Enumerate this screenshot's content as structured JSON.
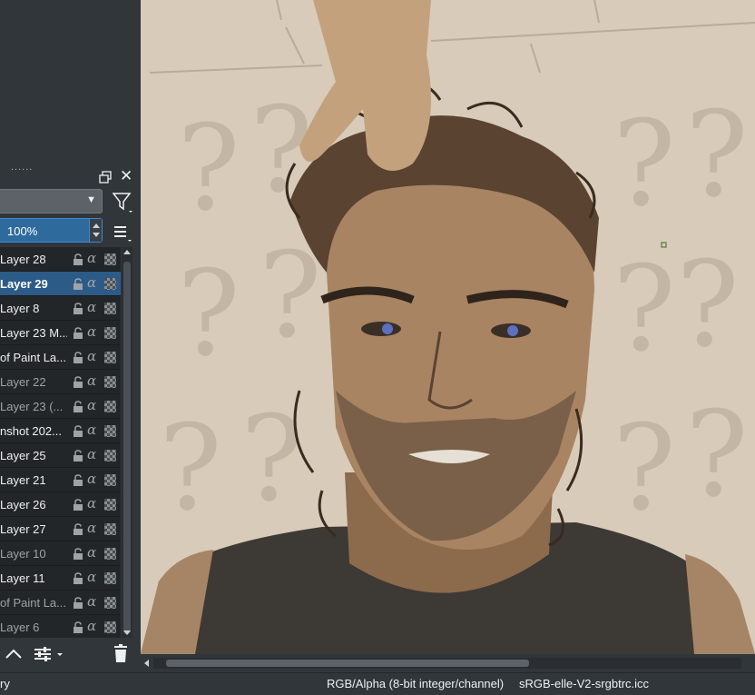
{
  "layers_panel": {
    "grip": "......",
    "opacity": "100%",
    "layers": [
      {
        "name": "Layer 28",
        "selected": false,
        "dim": false
      },
      {
        "name": "Layer 29",
        "selected": true,
        "dim": false
      },
      {
        "name": "Layer 8",
        "selected": false,
        "dim": false
      },
      {
        "name": "Layer 23 M...",
        "selected": false,
        "dim": false
      },
      {
        "name": "of Paint La...",
        "selected": false,
        "dim": false
      },
      {
        "name": "Layer 22",
        "selected": false,
        "dim": true
      },
      {
        "name": "Layer 23 (...",
        "selected": false,
        "dim": true
      },
      {
        "name": "nshot 202...",
        "selected": false,
        "dim": false
      },
      {
        "name": "Layer 25",
        "selected": false,
        "dim": false
      },
      {
        "name": "Layer 21",
        "selected": false,
        "dim": false
      },
      {
        "name": "Layer 26",
        "selected": false,
        "dim": false
      },
      {
        "name": "Layer 27",
        "selected": false,
        "dim": false
      },
      {
        "name": "Layer 10",
        "selected": false,
        "dim": true
      },
      {
        "name": "Layer 11",
        "selected": false,
        "dim": false
      },
      {
        "name": "of Paint La...",
        "selected": false,
        "dim": true
      },
      {
        "name": "Layer 6",
        "selected": false,
        "dim": true
      }
    ]
  },
  "statusbar": {
    "left_text": "ry",
    "color_model": "RGB/Alpha (8-bit integer/channel)",
    "profile": "sRGB-elle-V2-srgbtrc.icc"
  },
  "colors": {
    "accent": "#2c5b88",
    "panel_bg": "#31363b",
    "list_bg": "#232629",
    "canvas_bg": "#d8cbb9"
  }
}
